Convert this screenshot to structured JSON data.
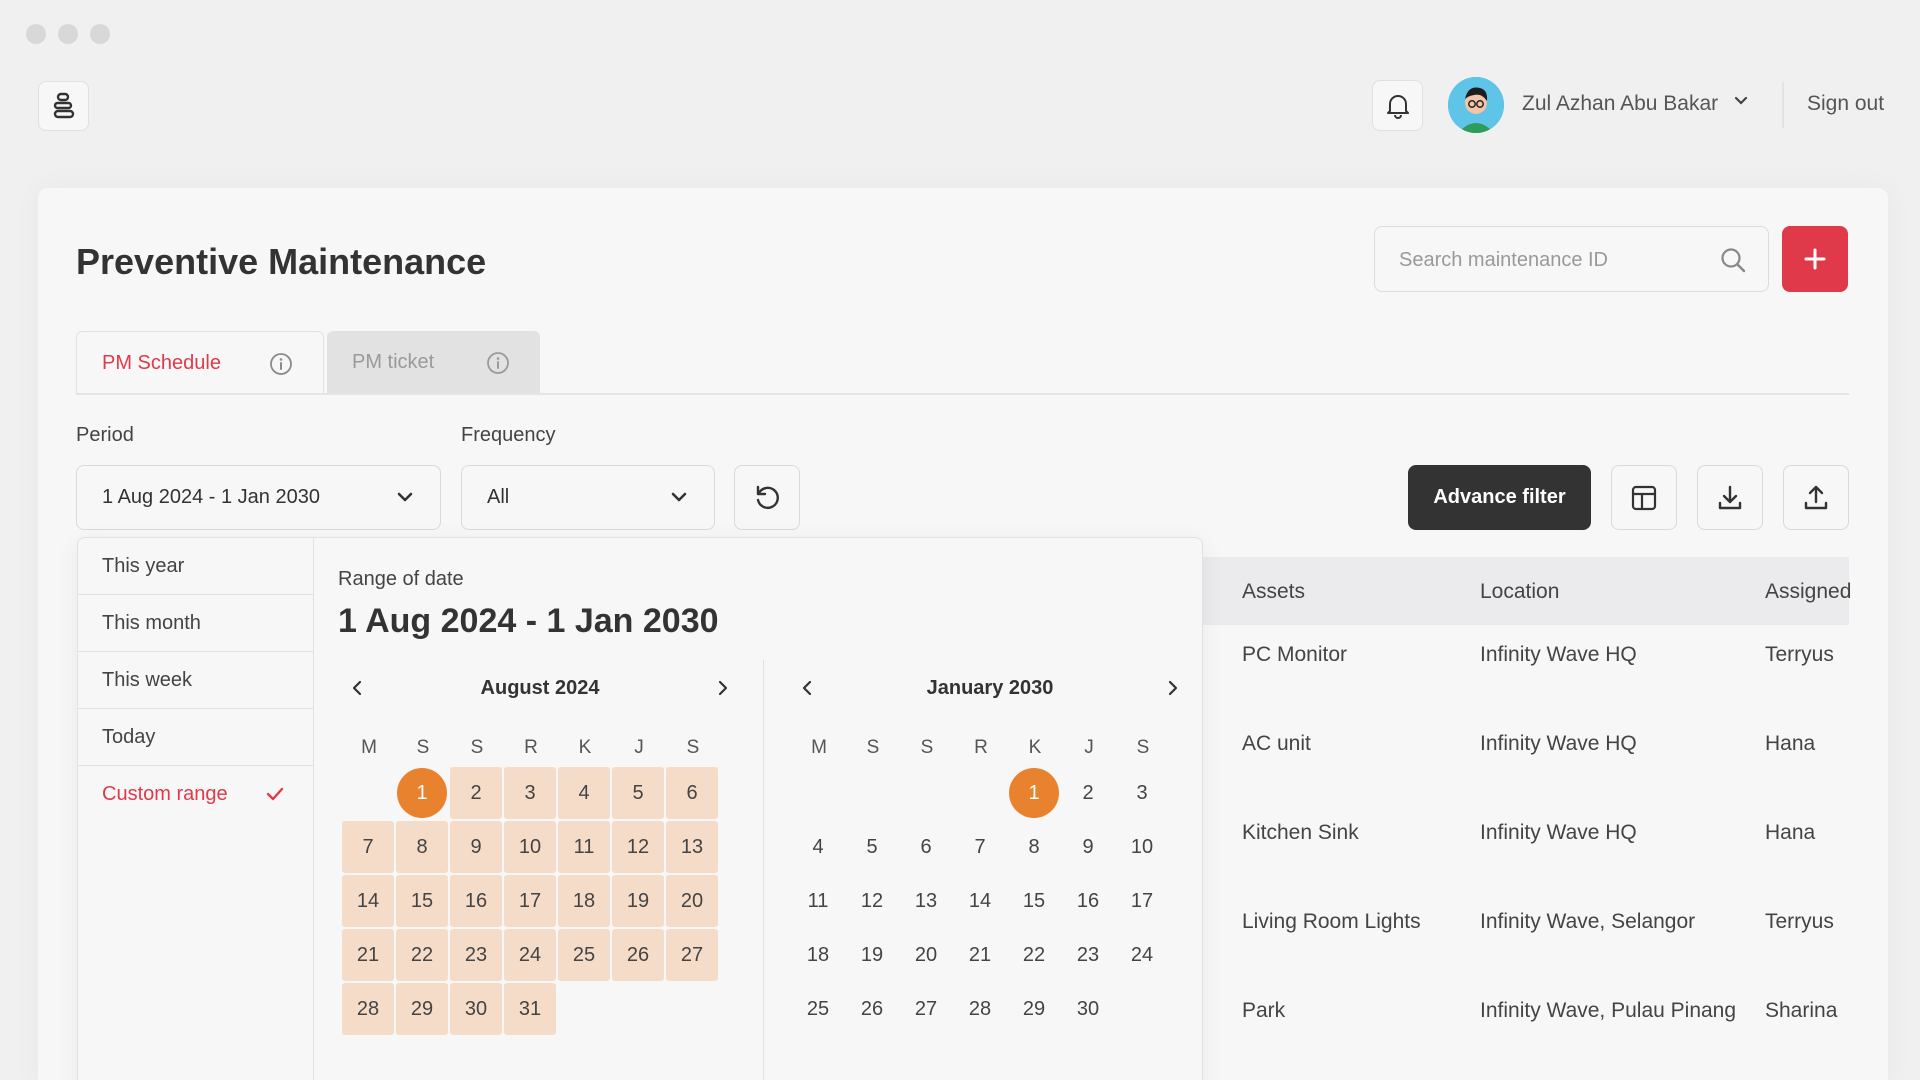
{
  "header": {
    "user_name": "Zul Azhan Abu Bakar",
    "sign_out": "Sign out"
  },
  "page": {
    "title": "Preventive Maintenance",
    "search_placeholder": "Search maintenance ID"
  },
  "tabs": [
    {
      "label": "PM Schedule",
      "active": true
    },
    {
      "label": "PM ticket",
      "active": false
    }
  ],
  "filters": {
    "period_label": "Period",
    "period_value": "1 Aug 2024 - 1 Jan 2030",
    "frequency_label": "Frequency",
    "frequency_value": "All",
    "advance_filter": "Advance filter"
  },
  "date_picker": {
    "presets": [
      "This year",
      "This month",
      "This week",
      "Today",
      "Custom range"
    ],
    "active_preset": "Custom range",
    "range_label": "Range of date",
    "range_value": "1 Aug 2024 - 1 Jan 2030",
    "weekdays": [
      "M",
      "S",
      "S",
      "R",
      "K",
      "J",
      "S"
    ],
    "calendars": [
      {
        "title": "August 2024",
        "weeks": [
          [
            "",
            "1",
            "2",
            "3",
            "4",
            "5",
            "6"
          ],
          [
            "7",
            "8",
            "9",
            "10",
            "11",
            "12",
            "13"
          ],
          [
            "14",
            "15",
            "16",
            "17",
            "18",
            "19",
            "20"
          ],
          [
            "21",
            "22",
            "23",
            "24",
            "25",
            "26",
            "27"
          ],
          [
            "28",
            "29",
            "30",
            "31",
            "",
            "",
            ""
          ]
        ],
        "selected": "1",
        "in_range": true
      },
      {
        "title": "January 2030",
        "weeks": [
          [
            "",
            "",
            "",
            "",
            "1",
            "2",
            "3"
          ],
          [
            "4",
            "5",
            "6",
            "7",
            "8",
            "9",
            "10"
          ],
          [
            "11",
            "12",
            "13",
            "14",
            "15",
            "16",
            "17"
          ],
          [
            "18",
            "19",
            "20",
            "21",
            "22",
            "23",
            "24"
          ],
          [
            "25",
            "26",
            "27",
            "28",
            "29",
            "30",
            ""
          ]
        ],
        "selected": "1",
        "in_range": false
      }
    ]
  },
  "table": {
    "columns": [
      "Assets",
      "Location",
      "Assigned"
    ],
    "rows": [
      [
        "PC Monitor",
        "Infinity Wave HQ",
        "Terryus"
      ],
      [
        "AC unit",
        "Infinity Wave HQ",
        "Hana"
      ],
      [
        "Kitchen Sink",
        "Infinity Wave HQ",
        "Hana"
      ],
      [
        "Living Room Lights",
        "Infinity Wave, Selangor",
        "Terryus"
      ],
      [
        "Park",
        "Infinity Wave, Pulau Pinang",
        "Sharina"
      ]
    ]
  },
  "colors": {
    "accent": "#e03a4a",
    "selected_day": "#e8822e",
    "range_fill": "#f5dcc9",
    "dark_button": "#333333"
  }
}
